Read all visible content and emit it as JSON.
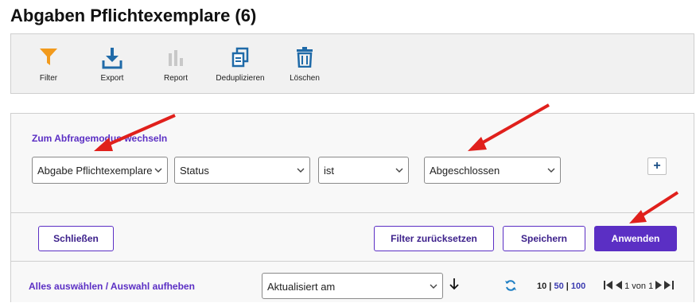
{
  "page": {
    "title": "Abgaben Pflichtexemplare (6)"
  },
  "toolbar": {
    "items": [
      {
        "label": "Filter",
        "icon": "filter-icon",
        "color": "#f29a1c"
      },
      {
        "label": "Export",
        "icon": "export-icon",
        "color": "#1f6aa8"
      },
      {
        "label": "Report",
        "icon": "report-icon",
        "color": "#c8c8c8"
      },
      {
        "label": "Deduplizieren",
        "icon": "deduplicate-icon",
        "color": "#1f6aa8"
      },
      {
        "label": "Löschen",
        "icon": "trash-icon",
        "color": "#1f6aa8"
      }
    ]
  },
  "filter": {
    "mode_link": "Zum Abfragemodus wechseln",
    "field": "Abgabe Pflichtexemplare",
    "attribute": "Status",
    "operator": "ist",
    "value": "Abgeschlossen",
    "add_label": "+"
  },
  "actions": {
    "close": "Schließen",
    "reset": "Filter zurücksetzen",
    "save": "Speichern",
    "apply": "Anwenden"
  },
  "list": {
    "select_all": "Alles auswählen / Auswahl aufheben",
    "sort_by": "Aktualisiert am",
    "page_sizes": [
      "10",
      "50",
      "100"
    ],
    "pager_text": "1 von 1"
  },
  "colors": {
    "accent": "#5b2fc4",
    "annotation_arrow": "#e0201c"
  }
}
